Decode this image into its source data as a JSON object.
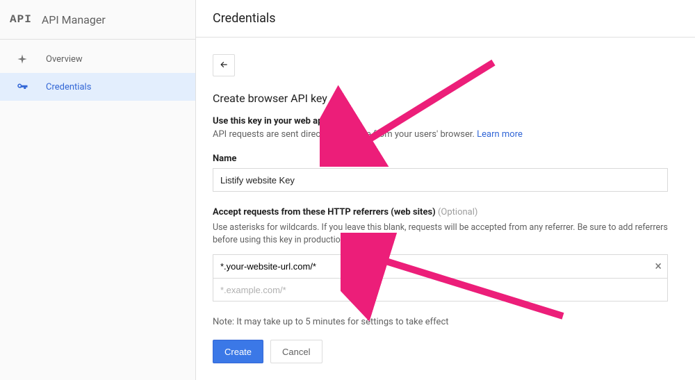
{
  "sidebar": {
    "logo_text": "API",
    "title": "API Manager",
    "items": [
      {
        "label": "Overview"
      },
      {
        "label": "Credentials"
      }
    ]
  },
  "header": {
    "title": "Credentials"
  },
  "form": {
    "section_title": "Create browser API key",
    "use_line": "Use this key in your web application",
    "api_desc_prefix": "API requests are sent directly to Google from your users' browser. ",
    "learn_more": "Learn more",
    "name_label": "Name",
    "name_value": "Listify website Key",
    "referrers_label": "Accept requests from these HTTP referrers (web sites)",
    "optional": " (Optional)",
    "referrers_help": "Use asterisks for wildcards. If you leave this blank, requests will be accepted from any referrer. Be sure to add referrers before using this key in production.",
    "referrer_value": "*.your-website-url.com/*",
    "referrer_placeholder": "*.example.com/*",
    "note": "Note: It may take up to 5 minutes for settings to take effect",
    "create_label": "Create",
    "cancel_label": "Cancel"
  }
}
